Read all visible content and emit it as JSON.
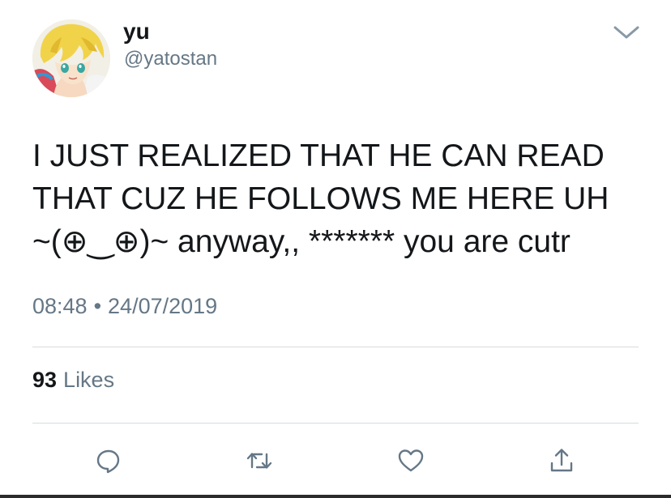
{
  "user": {
    "display_name": "yu",
    "handle": "@yatostan"
  },
  "tweet": {
    "lines": [
      "I JUST REALIZED THAT HE CAN READ",
      "THAT CUZ HE FOLLOWS ME HERE UH",
      "~(⊕‿⊕)~ anyway,, ******* you are cutr"
    ],
    "time": "08:48",
    "separator": "•",
    "date": "24/07/2019"
  },
  "stats": {
    "likes_count": "93",
    "likes_label": "Likes"
  },
  "icons": {
    "menu": "chevron-down-icon",
    "reply": "reply-icon",
    "retweet": "retweet-icon",
    "like": "heart-icon",
    "share": "share-icon"
  },
  "colors": {
    "text_primary": "#14171a",
    "text_secondary": "#657786",
    "divider": "#d6dbdf",
    "icon": "#657786"
  }
}
